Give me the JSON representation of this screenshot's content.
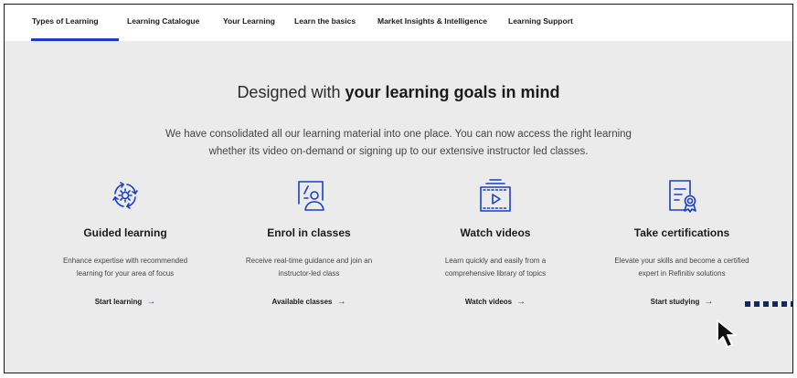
{
  "nav": {
    "items": [
      {
        "label": "Types of Learning",
        "active": true
      },
      {
        "label": "Learning Catalogue"
      },
      {
        "label": "Your Learning"
      },
      {
        "label": "Learn the basics"
      },
      {
        "label": "Market Insights & Intelligence"
      },
      {
        "label": "Learning Support"
      }
    ]
  },
  "hero": {
    "headline_prefix": "Designed with ",
    "headline_bold": "your learning goals in mind",
    "intro_line1": "We have consolidated all our learning material into one place. You can now access the right learning",
    "intro_line2": "whether its video on-demand or signing up to our extensive instructor led classes."
  },
  "cards": [
    {
      "icon": "guided-learning-icon",
      "title": "Guided learning",
      "desc_line1": "Enhance expertise with recommended",
      "desc_line2": "learning for your area of focus",
      "link": "Start learning"
    },
    {
      "icon": "enrol-classes-icon",
      "title": "Enrol in classes",
      "desc_line1": "Receive real-time guidance and join an",
      "desc_line2": "instructor-led class",
      "link": "Available classes"
    },
    {
      "icon": "video-icon",
      "title": "Watch videos",
      "desc_line1": "Learn quickly and easily from a",
      "desc_line2": "comprehensive library of topics",
      "link": "Watch videos"
    },
    {
      "icon": "certificate-icon",
      "title": "Take certifications",
      "desc_line1": "Elevate your skills and become a certified",
      "desc_line2": "expert in Refinitiv solutions",
      "link": "Start studying"
    }
  ],
  "arrow_glyph": "→",
  "colors": {
    "accent": "#1a3ec8",
    "background": "#ebebeb",
    "nav_background": "#ffffff",
    "text": "#1a1a1a",
    "dots": "#102a5e"
  }
}
